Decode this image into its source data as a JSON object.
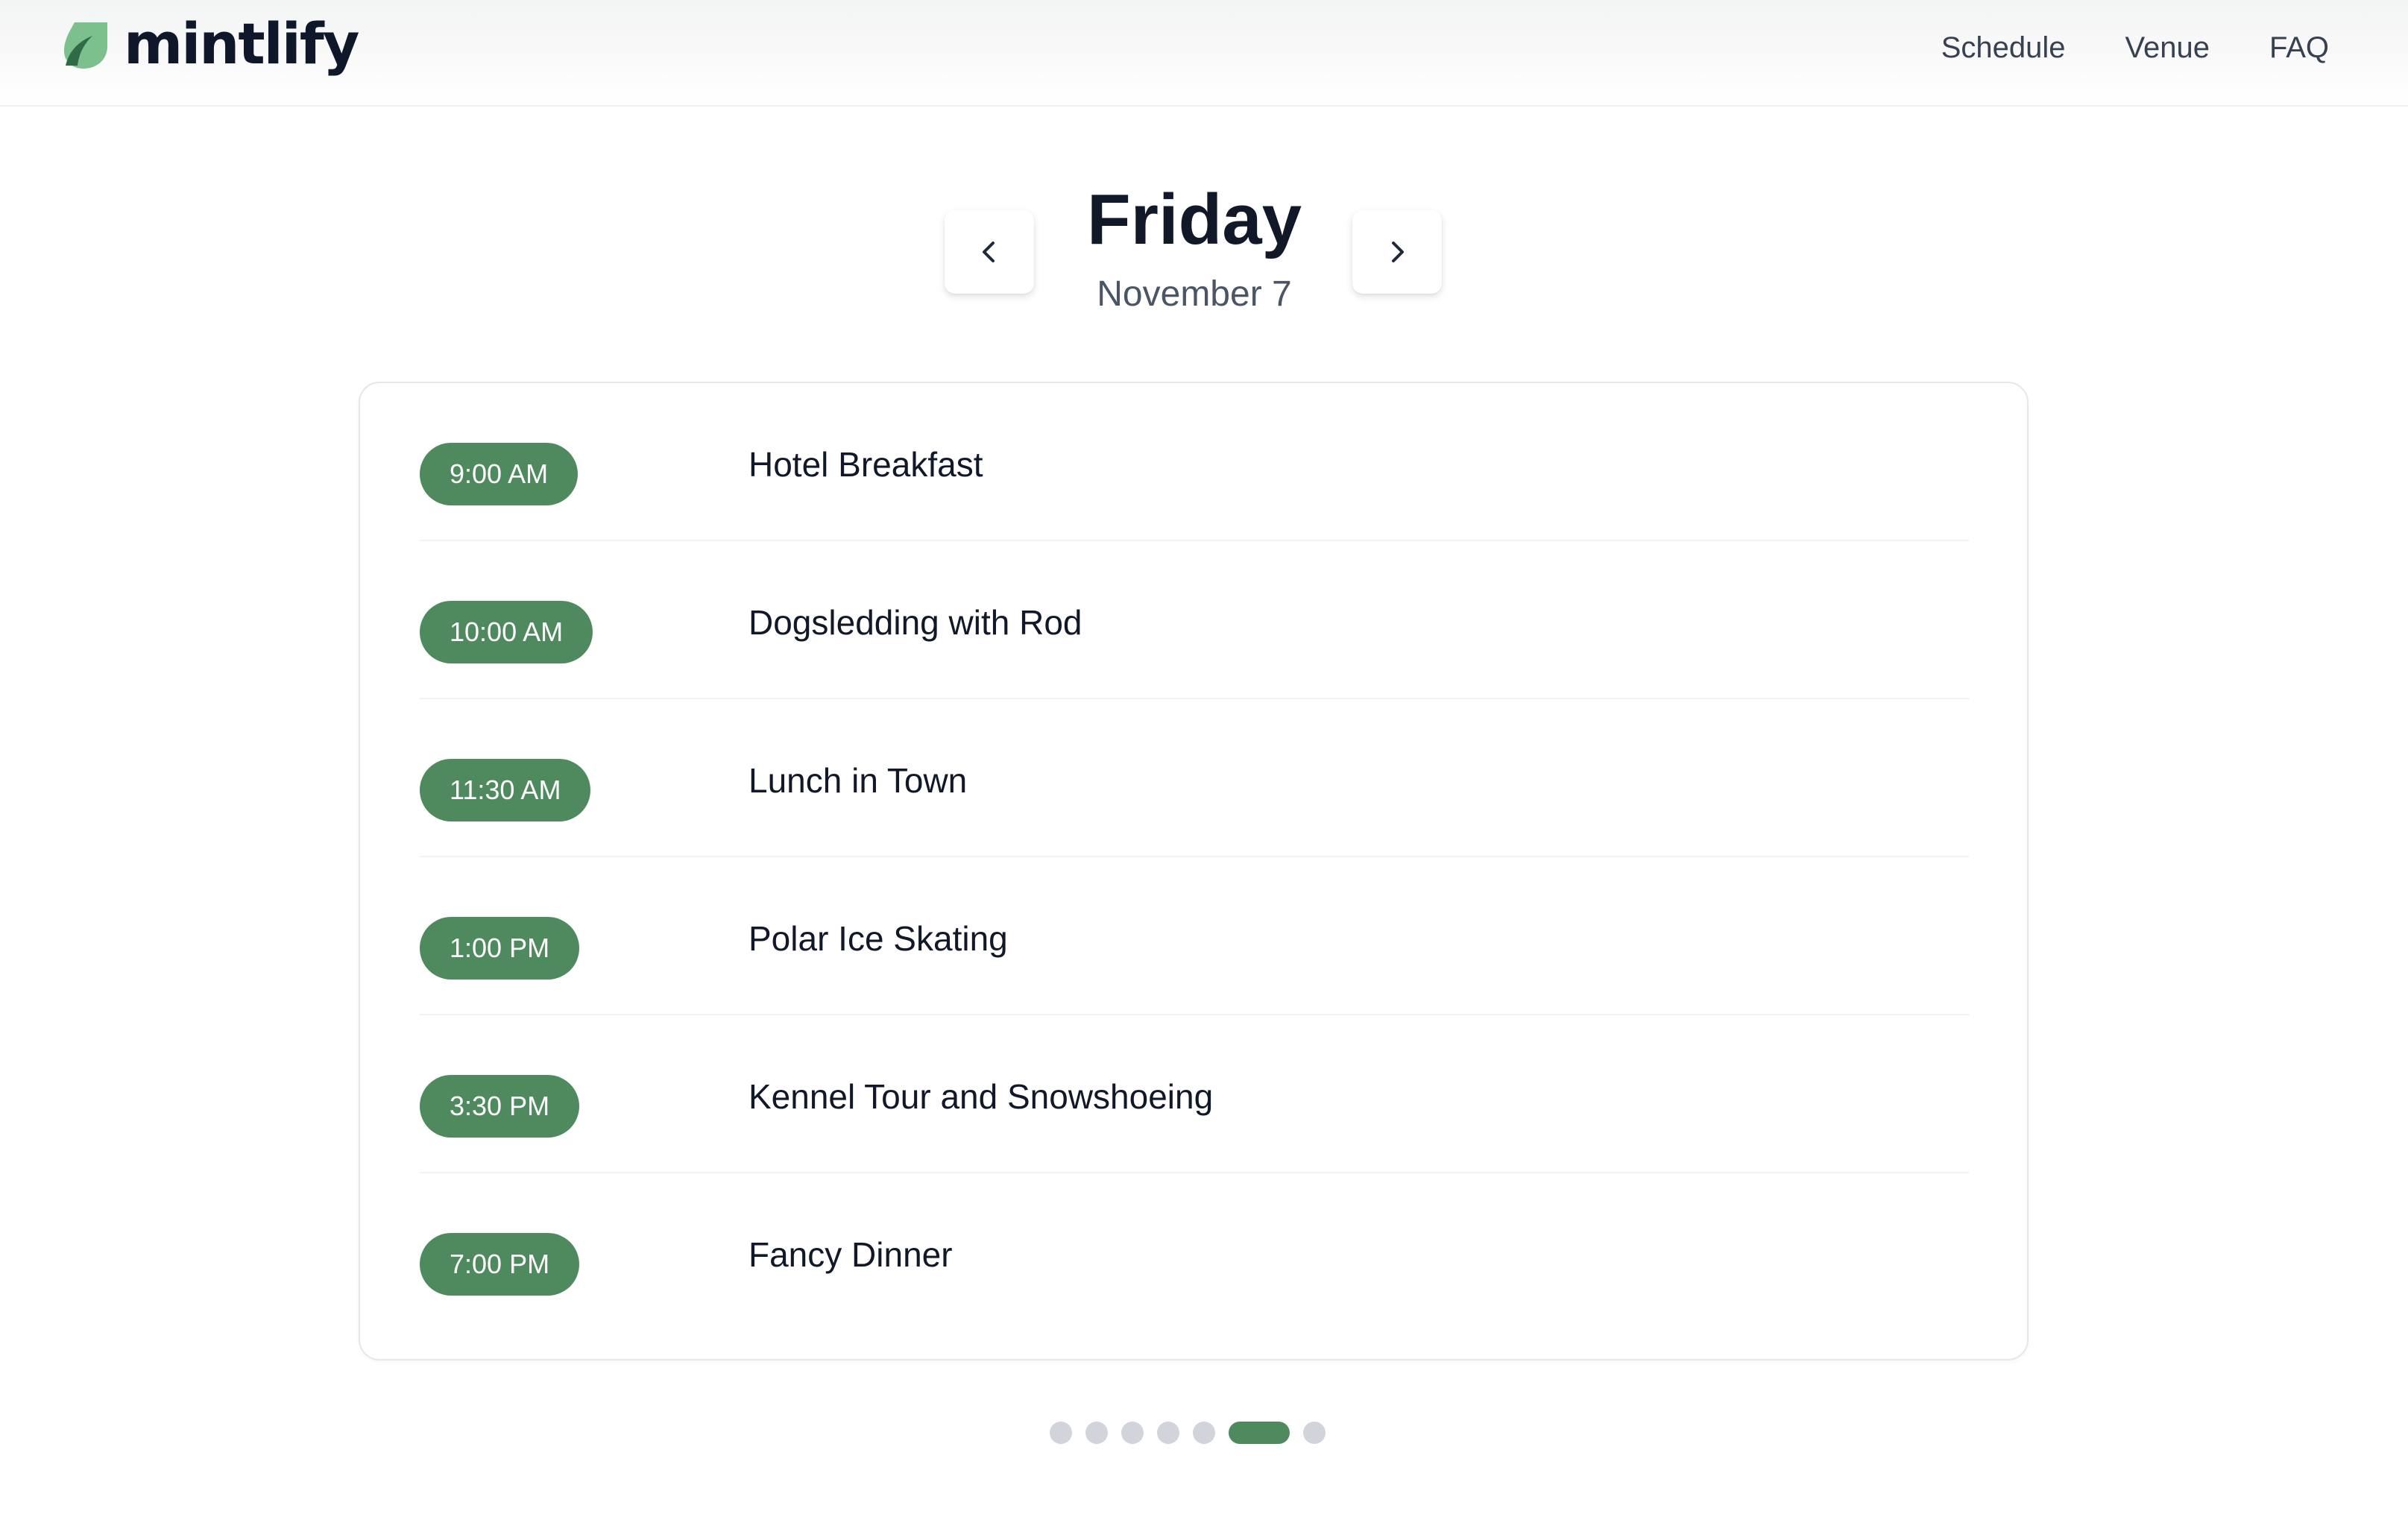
{
  "brand": {
    "name": "mintlify",
    "logo_icon": "mintlify-leaf-icon",
    "colors": {
      "light": "#7cc08d",
      "dark": "#2f6b45"
    }
  },
  "nav": {
    "items": [
      {
        "label": "Schedule"
      },
      {
        "label": "Venue"
      },
      {
        "label": "FAQ"
      }
    ]
  },
  "day": {
    "title": "Friday",
    "date": "November 7",
    "prev_icon": "chevron-left-icon",
    "next_icon": "chevron-right-icon"
  },
  "schedule": {
    "accent_color": "#4f8a5f",
    "events": [
      {
        "time": "9:00 AM",
        "title": "Hotel Breakfast"
      },
      {
        "time": "10:00 AM",
        "title": "Dogsledding with Rod"
      },
      {
        "time": "11:30 AM",
        "title": "Lunch in Town"
      },
      {
        "time": "1:00 PM",
        "title": "Polar Ice Skating"
      },
      {
        "time": "3:30 PM",
        "title": "Kennel Tour and Snowshoeing"
      },
      {
        "time": "7:00 PM",
        "title": "Fancy Dinner"
      }
    ]
  },
  "pagination": {
    "total": 7,
    "active_index": 5
  }
}
